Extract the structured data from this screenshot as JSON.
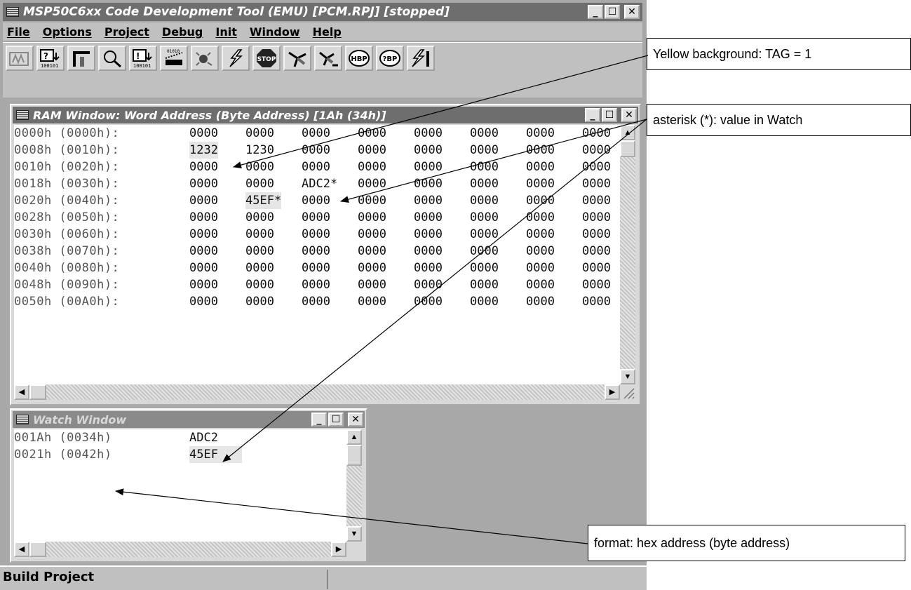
{
  "app": {
    "title": "MSP50C6xx Code Development Tool (EMU) [PCM.RPJ] [stopped]"
  },
  "menu": [
    "File",
    "Options",
    "Project",
    "Debug",
    "Init",
    "Window",
    "Help"
  ],
  "toolbar": {
    "buttons": [
      "ram-tool-icon",
      "download-icon",
      "step-icon",
      "find-icon",
      "upload-icon",
      "memory-icon",
      "breakpoint-icon",
      "run-icon",
      "stop-icon",
      "probe-icon",
      "probe-step-icon",
      "hardware-breakpoint-icon",
      "program-breakpoint-icon",
      "run-all-icon"
    ],
    "stop_label": "STOP",
    "hbp_label": "HBP",
    "pbp_label": "?BP"
  },
  "ram_window": {
    "title": "RAM Window: Word Address (Byte Address) [1Ah (34h)]",
    "rows": [
      {
        "addr": "0000h (0000h):",
        "cells": [
          "0000",
          "0000",
          "0000",
          "0000",
          "0000",
          "0000",
          "0000",
          "0000"
        ]
      },
      {
        "addr": "0008h (0010h):",
        "cells": [
          "1232",
          "1230",
          "0000",
          "0000",
          "0000",
          "0000",
          "0000",
          "0000"
        ]
      },
      {
        "addr": "0010h (0020h):",
        "cells": [
          "0000",
          "0000",
          "0000",
          "0000",
          "0000",
          "0000",
          "0000",
          "0000"
        ]
      },
      {
        "addr": "0018h (0030h):",
        "cells": [
          "0000",
          "0000",
          "ADC2*",
          "0000",
          "0000",
          "0000",
          "0000",
          "0000"
        ]
      },
      {
        "addr": "0020h (0040h):",
        "cells": [
          "0000",
          "45EF*",
          "0000",
          "0000",
          "0000",
          "0000",
          "0000",
          "0000"
        ]
      },
      {
        "addr": "0028h (0050h):",
        "cells": [
          "0000",
          "0000",
          "0000",
          "0000",
          "0000",
          "0000",
          "0000",
          "0000"
        ]
      },
      {
        "addr": "0030h (0060h):",
        "cells": [
          "0000",
          "0000",
          "0000",
          "0000",
          "0000",
          "0000",
          "0000",
          "0000"
        ]
      },
      {
        "addr": "0038h (0070h):",
        "cells": [
          "0000",
          "0000",
          "0000",
          "0000",
          "0000",
          "0000",
          "0000",
          "0000"
        ]
      },
      {
        "addr": "0040h (0080h):",
        "cells": [
          "0000",
          "0000",
          "0000",
          "0000",
          "0000",
          "0000",
          "0000",
          "0000"
        ]
      },
      {
        "addr": "0048h (0090h):",
        "cells": [
          "0000",
          "0000",
          "0000",
          "0000",
          "0000",
          "0000",
          "0000",
          "0000"
        ]
      },
      {
        "addr": "0050h (00A0h):",
        "cells": [
          "0000",
          "0000",
          "0000",
          "0000",
          "0000",
          "0000",
          "0000",
          "0000"
        ]
      }
    ],
    "tagged_cells": [
      "1-0",
      "4-1"
    ]
  },
  "watch_window": {
    "title": "Watch Window",
    "rows": [
      {
        "addr": "001Ah (0034h)",
        "value": "ADC2",
        "tagged": false
      },
      {
        "addr": "0021h (0042h)",
        "value": "45EF",
        "tagged": true
      }
    ]
  },
  "status": {
    "text": "Build Project"
  },
  "annotations": {
    "yellow": "Yellow background: TAG = 1",
    "asterisk": "asterisk (*): value in Watch",
    "format": "format: hex address (byte address)"
  }
}
